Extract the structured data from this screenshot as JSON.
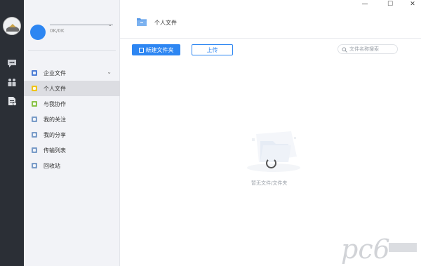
{
  "window": {
    "minimize": "—",
    "maximize": "☐",
    "close": "✕"
  },
  "user": {
    "quota": "0K/0K"
  },
  "sidebar": {
    "items": [
      {
        "label": "企业文件",
        "color": "#4f7fd6",
        "expandable": true
      },
      {
        "label": "个人文件",
        "color": "#f0c419",
        "active": true
      },
      {
        "label": "与我协作",
        "color": "#8ac24a"
      },
      {
        "label": "我的关注",
        "color": "#7a9cc8"
      },
      {
        "label": "我的分享",
        "color": "#7a9cc8"
      },
      {
        "label": "传输列表",
        "color": "#7a9cc8"
      },
      {
        "label": "回收站",
        "color": "#7a9cc8"
      }
    ]
  },
  "header": {
    "title": "个人文件"
  },
  "toolbar": {
    "new_folder": "新建文件夹",
    "upload": "上传"
  },
  "search": {
    "placeholder": "文件名称搜索"
  },
  "empty": {
    "text": "暂无文件/文件夹"
  },
  "watermark": {
    "text": "pc6 下载站"
  },
  "colors": {
    "accent": "#2d86f2",
    "rail": "#2b2f36",
    "sidebar": "#f2f3f7"
  }
}
